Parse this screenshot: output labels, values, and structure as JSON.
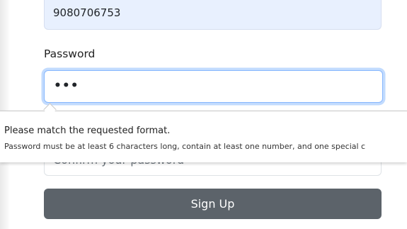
{
  "form": {
    "phone_value": "9080706753",
    "password_label": "Password",
    "password_value": "•••",
    "confirm_placeholder": "Confirm your password",
    "signup_label": "Sign Up"
  },
  "validation_tooltip": {
    "title": "Please match the requested format.",
    "detail": "Password must be at least 6 characters long, contain at least one number, and one special c"
  },
  "colors": {
    "phone_autofill_bg": "#e8f0fe",
    "focus_border": "#86b7fe",
    "button_bg": "#5c636a"
  }
}
